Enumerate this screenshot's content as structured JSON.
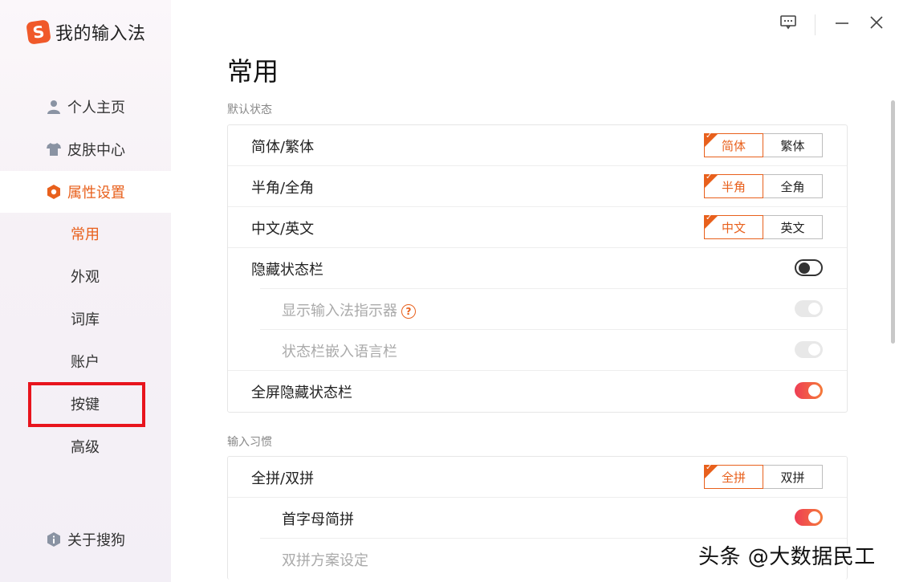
{
  "app": {
    "logo_letter": "S",
    "title": "我的输入法"
  },
  "sidebar": {
    "items": [
      {
        "label": "个人主页",
        "icon": "user-icon"
      },
      {
        "label": "皮肤中心",
        "icon": "shirt-icon"
      },
      {
        "label": "属性设置",
        "icon": "settings-hex-icon",
        "active": true
      }
    ],
    "sub_items": [
      "常用",
      "外观",
      "词库",
      "账户",
      "按键",
      "高级"
    ],
    "active_sub": "常用",
    "footer": {
      "label": "关于搜狗",
      "icon": "info-icon"
    }
  },
  "main": {
    "page_title": "常用",
    "sections": [
      {
        "label": "默认状态",
        "rows": [
          {
            "label": "简体/繁体",
            "control": "segment",
            "options": [
              "简体",
              "繁体"
            ],
            "selected": "简体"
          },
          {
            "label": "半角/全角",
            "control": "segment",
            "options": [
              "半角",
              "全角"
            ],
            "selected": "半角"
          },
          {
            "label": "中文/英文",
            "control": "segment",
            "options": [
              "中文",
              "英文"
            ],
            "selected": "中文"
          },
          {
            "label": "隐藏状态栏",
            "control": "toggle",
            "state": "off"
          },
          {
            "label": "显示输入法指示器",
            "control": "toggle",
            "state": "disabled",
            "sub": true,
            "help": "?"
          },
          {
            "label": "状态栏嵌入语言栏",
            "control": "toggle",
            "state": "disabled",
            "sub": true
          },
          {
            "label": "全屏隐藏状态栏",
            "control": "toggle",
            "state": "on"
          }
        ]
      },
      {
        "label": "输入习惯",
        "rows": [
          {
            "label": "全拼/双拼",
            "control": "segment",
            "options": [
              "全拼",
              "双拼"
            ],
            "selected": "全拼"
          },
          {
            "label": "首字母简拼",
            "control": "toggle",
            "state": "on",
            "sub": true
          },
          {
            "label": "双拼方案设定",
            "control": "none",
            "sub": true,
            "dim": true
          }
        ]
      }
    ]
  },
  "watermark": "头条 @大数据民工",
  "colors": {
    "accent": "#e8601c",
    "highlight_box": "#e8141d",
    "toggle_on_start": "#ee3e55",
    "toggle_on_end": "#f57a3a"
  }
}
